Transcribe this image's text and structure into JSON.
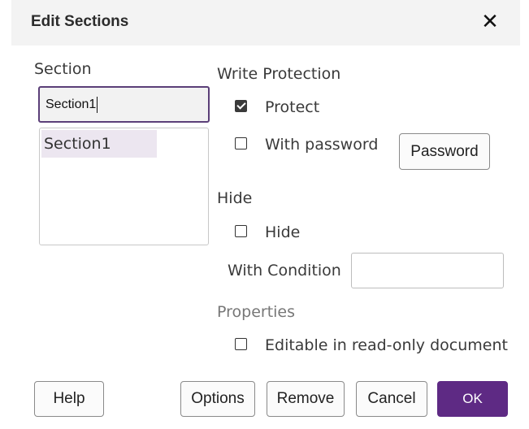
{
  "dialog": {
    "title": "Edit Sections",
    "close_icon": "close-icon"
  },
  "section": {
    "label": "Section",
    "name_value": "Section1",
    "list_items": [
      "Section1"
    ]
  },
  "write_protection": {
    "heading": "Write Protection",
    "protect_label": "Protect",
    "protect_checked": true,
    "with_password_label": "With password",
    "with_password_checked": false,
    "password_button": "Password"
  },
  "hide": {
    "heading": "Hide",
    "hide_label": "Hide",
    "hide_checked": false,
    "with_condition_label": "With Condition",
    "with_condition_value": ""
  },
  "properties": {
    "heading": "Properties",
    "editable_label": "Editable in read-only document",
    "editable_checked": false
  },
  "buttons": {
    "help": "Help",
    "options": "Options",
    "remove": "Remove",
    "cancel": "Cancel",
    "ok": "OK"
  },
  "colors": {
    "accent": "#5e2a84",
    "focus_border": "#5b3f78",
    "selection": "#ece6f0"
  }
}
